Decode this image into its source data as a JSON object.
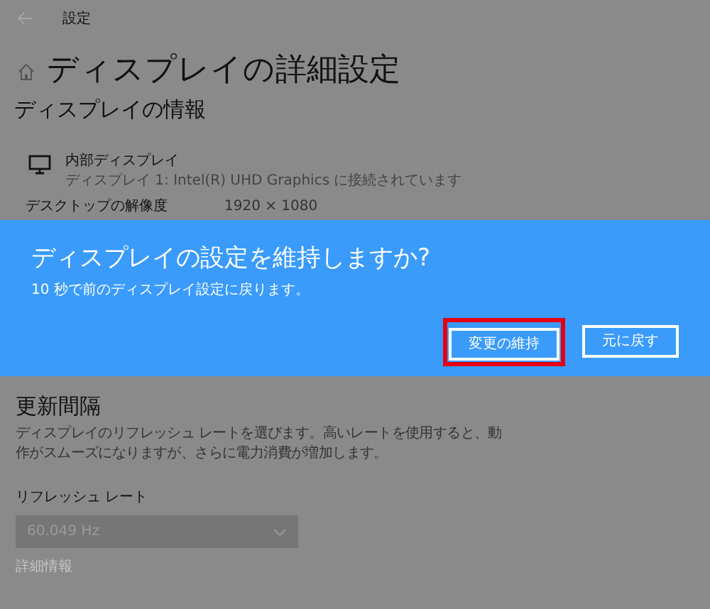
{
  "window": {
    "title": "設定"
  },
  "page_title": "ディスプレイの詳細設定",
  "display_info": {
    "heading": "ディスプレイの情報",
    "display_name": "内部ディスプレイ",
    "display_detail": "ディスプレイ 1: Intel(R) UHD Graphics に接続されています",
    "resolution_label": "デスクトップの解像度",
    "resolution_value": "1920 × 1080"
  },
  "dialog": {
    "title": "ディスプレイの設定を維持しますか?",
    "message": "10 秒で前のディスプレイ設定に戻ります。",
    "buttons": [
      {
        "label": "変更の維持",
        "highlighted": true
      },
      {
        "label": "元に戻す",
        "highlighted": false
      }
    ]
  },
  "refresh": {
    "heading": "更新間隔",
    "description": "ディスプレイのリフレッシュ レートを選びます。高いレートを使用すると、動作がスムーズになりますが、さらに電力消費が増加します。",
    "label": "リフレッシュ レート",
    "value": "60.049 Hz",
    "link": "詳細情報"
  }
}
